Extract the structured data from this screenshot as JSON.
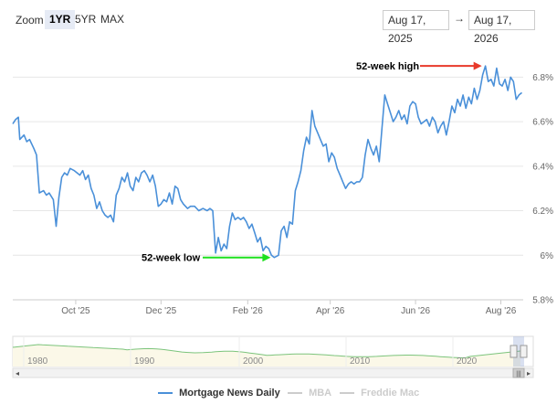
{
  "toolbar": {
    "zoom_label": "Zoom",
    "buttons": [
      "1YR",
      "5YR",
      "MAX"
    ],
    "active": "1YR",
    "date_from": "Aug 17, 2025",
    "date_arrow": "→",
    "date_to": "Aug 17, 2026"
  },
  "chart_data": {
    "type": "line",
    "x_axis_labels": [
      "Oct '25",
      "Dec '25",
      "Feb '26",
      "Apr '26",
      "Jun '26",
      "Aug '26"
    ],
    "y_axis_labels": [
      "5.8%",
      "6%",
      "6.2%",
      "6.4%",
      "6.6%",
      "6.8%"
    ],
    "ylim": [
      5.8,
      6.9
    ],
    "grid": true,
    "series": [
      {
        "name": "Mortgage News Daily",
        "color": "#4a90d9",
        "values": [
          [
            "2025-08-17",
            6.59
          ],
          [
            "2025-08-19",
            6.61
          ],
          [
            "2025-08-21",
            6.62
          ],
          [
            "2025-08-22",
            6.52
          ],
          [
            "2025-08-25",
            6.54
          ],
          [
            "2025-08-27",
            6.51
          ],
          [
            "2025-08-29",
            6.52
          ],
          [
            "2025-09-01",
            6.48
          ],
          [
            "2025-09-03",
            6.45
          ],
          [
            "2025-09-05",
            6.28
          ],
          [
            "2025-09-08",
            6.29
          ],
          [
            "2025-09-10",
            6.27
          ],
          [
            "2025-09-12",
            6.28
          ],
          [
            "2025-09-15",
            6.25
          ],
          [
            "2025-09-17",
            6.13
          ],
          [
            "2025-09-19",
            6.26
          ],
          [
            "2025-09-21",
            6.35
          ],
          [
            "2025-09-23",
            6.37
          ],
          [
            "2025-09-25",
            6.36
          ],
          [
            "2025-09-27",
            6.39
          ],
          [
            "2025-09-30",
            6.38
          ],
          [
            "2025-10-02",
            6.37
          ],
          [
            "2025-10-04",
            6.36
          ],
          [
            "2025-10-06",
            6.38
          ],
          [
            "2025-10-08",
            6.34
          ],
          [
            "2025-10-10",
            6.36
          ],
          [
            "2025-10-12",
            6.3
          ],
          [
            "2025-10-14",
            6.27
          ],
          [
            "2025-10-16",
            6.21
          ],
          [
            "2025-10-18",
            6.24
          ],
          [
            "2025-10-20",
            6.2
          ],
          [
            "2025-10-22",
            6.18
          ],
          [
            "2025-10-24",
            6.17
          ],
          [
            "2025-10-26",
            6.18
          ],
          [
            "2025-10-28",
            6.15
          ],
          [
            "2025-10-30",
            6.27
          ],
          [
            "2025-11-01",
            6.3
          ],
          [
            "2025-11-03",
            6.35
          ],
          [
            "2025-11-05",
            6.33
          ],
          [
            "2025-11-07",
            6.37
          ],
          [
            "2025-11-09",
            6.31
          ],
          [
            "2025-11-11",
            6.29
          ],
          [
            "2025-11-13",
            6.35
          ],
          [
            "2025-11-15",
            6.33
          ],
          [
            "2025-11-17",
            6.37
          ],
          [
            "2025-11-19",
            6.38
          ],
          [
            "2025-11-21",
            6.36
          ],
          [
            "2025-11-23",
            6.33
          ],
          [
            "2025-11-25",
            6.36
          ],
          [
            "2025-11-27",
            6.31
          ],
          [
            "2025-11-29",
            6.22
          ],
          [
            "2025-12-01",
            6.23
          ],
          [
            "2025-12-03",
            6.25
          ],
          [
            "2025-12-05",
            6.24
          ],
          [
            "2025-12-07",
            6.28
          ],
          [
            "2025-12-09",
            6.23
          ],
          [
            "2025-12-11",
            6.31
          ],
          [
            "2025-12-13",
            6.3
          ],
          [
            "2025-12-15",
            6.25
          ],
          [
            "2025-12-17",
            6.23
          ],
          [
            "2025-12-20",
            6.21
          ],
          [
            "2025-12-22",
            6.22
          ],
          [
            "2025-12-25",
            6.22
          ],
          [
            "2025-12-28",
            6.2
          ],
          [
            "2025-12-31",
            6.21
          ],
          [
            "2026-01-03",
            6.2
          ],
          [
            "2026-01-05",
            6.21
          ],
          [
            "2026-01-07",
            6.2
          ],
          [
            "2026-01-09",
            6.01
          ],
          [
            "2026-01-11",
            6.08
          ],
          [
            "2026-01-13",
            6.02
          ],
          [
            "2026-01-15",
            6.05
          ],
          [
            "2026-01-17",
            6.03
          ],
          [
            "2026-01-19",
            6.13
          ],
          [
            "2026-01-21",
            6.19
          ],
          [
            "2026-01-23",
            6.16
          ],
          [
            "2026-01-25",
            6.17
          ],
          [
            "2026-01-27",
            6.16
          ],
          [
            "2026-01-29",
            6.17
          ],
          [
            "2026-01-31",
            6.15
          ],
          [
            "2026-02-02",
            6.12
          ],
          [
            "2026-02-04",
            6.14
          ],
          [
            "2026-02-06",
            6.1
          ],
          [
            "2026-02-08",
            6.06
          ],
          [
            "2026-02-10",
            6.08
          ],
          [
            "2026-02-12",
            6.02
          ],
          [
            "2026-02-14",
            6.04
          ],
          [
            "2026-02-16",
            6.03
          ],
          [
            "2026-02-18",
            6.0
          ],
          [
            "2026-02-20",
            5.99
          ],
          [
            "2026-02-23",
            6.0
          ],
          [
            "2026-02-25",
            6.11
          ],
          [
            "2026-02-27",
            6.13
          ],
          [
            "2026-03-01",
            6.08
          ],
          [
            "2026-03-03",
            6.15
          ],
          [
            "2026-03-05",
            6.14
          ],
          [
            "2026-03-07",
            6.29
          ],
          [
            "2026-03-09",
            6.33
          ],
          [
            "2026-03-11",
            6.38
          ],
          [
            "2026-03-13",
            6.47
          ],
          [
            "2026-03-15",
            6.53
          ],
          [
            "2026-03-17",
            6.5
          ],
          [
            "2026-03-19",
            6.65
          ],
          [
            "2026-03-21",
            6.58
          ],
          [
            "2026-03-23",
            6.55
          ],
          [
            "2026-03-25",
            6.52
          ],
          [
            "2026-03-27",
            6.49
          ],
          [
            "2026-03-29",
            6.5
          ],
          [
            "2026-03-31",
            6.42
          ],
          [
            "2026-04-02",
            6.46
          ],
          [
            "2026-04-04",
            6.44
          ],
          [
            "2026-04-06",
            6.39
          ],
          [
            "2026-04-08",
            6.36
          ],
          [
            "2026-04-10",
            6.33
          ],
          [
            "2026-04-12",
            6.3
          ],
          [
            "2026-04-14",
            6.32
          ],
          [
            "2026-04-16",
            6.33
          ],
          [
            "2026-04-18",
            6.32
          ],
          [
            "2026-04-20",
            6.33
          ],
          [
            "2026-04-22",
            6.33
          ],
          [
            "2026-04-24",
            6.35
          ],
          [
            "2026-04-26",
            6.45
          ],
          [
            "2026-04-28",
            6.52
          ],
          [
            "2026-04-30",
            6.48
          ],
          [
            "2026-05-02",
            6.45
          ],
          [
            "2026-05-04",
            6.49
          ],
          [
            "2026-05-06",
            6.42
          ],
          [
            "2026-05-08",
            6.57
          ],
          [
            "2026-05-10",
            6.72
          ],
          [
            "2026-05-12",
            6.68
          ],
          [
            "2026-05-14",
            6.64
          ],
          [
            "2026-05-16",
            6.6
          ],
          [
            "2026-05-18",
            6.62
          ],
          [
            "2026-05-20",
            6.65
          ],
          [
            "2026-05-22",
            6.61
          ],
          [
            "2026-05-24",
            6.63
          ],
          [
            "2026-05-26",
            6.59
          ],
          [
            "2026-05-28",
            6.67
          ],
          [
            "2026-05-30",
            6.69
          ],
          [
            "2026-06-01",
            6.68
          ],
          [
            "2026-06-03",
            6.62
          ],
          [
            "2026-06-05",
            6.59
          ],
          [
            "2026-06-07",
            6.6
          ],
          [
            "2026-06-09",
            6.61
          ],
          [
            "2026-06-11",
            6.58
          ],
          [
            "2026-06-13",
            6.62
          ],
          [
            "2026-06-15",
            6.6
          ],
          [
            "2026-06-17",
            6.55
          ],
          [
            "2026-06-19",
            6.58
          ],
          [
            "2026-06-21",
            6.6
          ],
          [
            "2026-06-23",
            6.54
          ],
          [
            "2026-06-25",
            6.6
          ],
          [
            "2026-06-27",
            6.67
          ],
          [
            "2026-06-29",
            6.64
          ],
          [
            "2026-07-01",
            6.7
          ],
          [
            "2026-07-03",
            6.67
          ],
          [
            "2026-07-05",
            6.72
          ],
          [
            "2026-07-07",
            6.66
          ],
          [
            "2026-07-09",
            6.71
          ],
          [
            "2026-07-11",
            6.68
          ],
          [
            "2026-07-13",
            6.75
          ],
          [
            "2026-07-15",
            6.7
          ],
          [
            "2026-07-17",
            6.74
          ],
          [
            "2026-07-19",
            6.81
          ],
          [
            "2026-07-21",
            6.85
          ],
          [
            "2026-07-23",
            6.78
          ],
          [
            "2026-07-25",
            6.79
          ],
          [
            "2026-07-27",
            6.76
          ],
          [
            "2026-07-29",
            6.84
          ],
          [
            "2026-07-31",
            6.77
          ],
          [
            "2026-08-02",
            6.76
          ],
          [
            "2026-08-04",
            6.79
          ],
          [
            "2026-08-06",
            6.74
          ],
          [
            "2026-08-08",
            6.8
          ],
          [
            "2026-08-10",
            6.78
          ],
          [
            "2026-08-12",
            6.7
          ],
          [
            "2026-08-14",
            6.72
          ],
          [
            "2026-08-16",
            6.73
          ]
        ]
      },
      {
        "name": "MBA",
        "color": "#cccccc",
        "values": []
      },
      {
        "name": "Freddie Mac",
        "color": "#cccccc",
        "values": []
      }
    ],
    "annotations": [
      {
        "text": "52-week high",
        "arrow_color": "#e8392a",
        "date": "2026-07-21",
        "value": 6.85
      },
      {
        "text": "52-week low",
        "arrow_color": "#1ee01e",
        "date": "2026-02-20",
        "value": 5.99
      }
    ]
  },
  "navigator": {
    "labels": [
      "1980",
      "1990",
      "2000",
      "2010",
      "2020"
    ],
    "line_color": "#7cc47c",
    "scroll_left": "◂",
    "scroll_right": "▸",
    "grip": "|||"
  },
  "legend": {
    "items": [
      {
        "label": "Mortgage News Daily",
        "color": "#4a90d9",
        "active": true
      },
      {
        "label": "MBA",
        "color": "#cccccc",
        "active": false
      },
      {
        "label": "Freddie Mac",
        "color": "#cccccc",
        "active": false
      }
    ]
  }
}
